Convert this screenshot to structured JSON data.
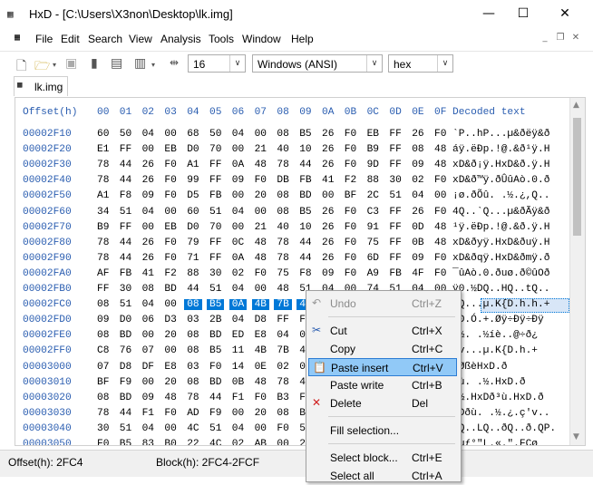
{
  "window": {
    "title": "HxD - [C:\\Users\\X3non\\Desktop\\lk.img]",
    "min_icon": "minimize-icon",
    "max_icon": "maximize-icon",
    "close_icon": "close-icon"
  },
  "menu": [
    "File",
    "Edit",
    "Search",
    "View",
    "Analysis",
    "Tools",
    "Window",
    "Help"
  ],
  "toolbar": {
    "bytes_per_row": "16",
    "charset": "Windows (ANSI)",
    "offset_base": "hex"
  },
  "tab": {
    "label": "lk.img"
  },
  "editor": {
    "offset_header": "Offset(h)",
    "columns": [
      "00",
      "01",
      "02",
      "03",
      "04",
      "05",
      "06",
      "07",
      "08",
      "09",
      "0A",
      "0B",
      "0C",
      "0D",
      "0E",
      "0F"
    ],
    "decoded_header": "Decoded text",
    "rows": [
      {
        "offset": "00002F10",
        "bytes": [
          "60",
          "50",
          "04",
          "00",
          "68",
          "50",
          "04",
          "00",
          "08",
          "B5",
          "26",
          "F0",
          "EB",
          "FF",
          "26",
          "F0"
        ],
        "decoded": "`P..hP...µ&ðëÿ&ð"
      },
      {
        "offset": "00002F20",
        "bytes": [
          "E1",
          "FF",
          "00",
          "EB",
          "D0",
          "70",
          "00",
          "21",
          "40",
          "10",
          "26",
          "F0",
          "B9",
          "FF",
          "08",
          "48"
        ],
        "decoded": "áÿ.ëÐp.!@.&ð¹ÿ.H"
      },
      {
        "offset": "00002F30",
        "bytes": [
          "78",
          "44",
          "26",
          "F0",
          "A1",
          "FF",
          "0A",
          "48",
          "78",
          "44",
          "26",
          "F0",
          "9D",
          "FF",
          "09",
          "48"
        ],
        "decoded": "xD&ð¡ÿ.HxD&ð.ÿ.H"
      },
      {
        "offset": "00002F40",
        "bytes": [
          "78",
          "44",
          "26",
          "F0",
          "99",
          "FF",
          "09",
          "F0",
          "DB",
          "FB",
          "41",
          "F2",
          "88",
          "30",
          "02",
          "F0"
        ],
        "decoded": "xD&ð™ÿ.ðÛûAò.0.ð"
      },
      {
        "offset": "00002F50",
        "bytes": [
          "A1",
          "F8",
          "09",
          "F0",
          "D5",
          "FB",
          "00",
          "20",
          "08",
          "BD",
          "00",
          "BF",
          "2C",
          "51",
          "04",
          "00"
        ],
        "decoded": "¡ø.ðÕû. .½.¿,Q.."
      },
      {
        "offset": "00002F60",
        "bytes": [
          "34",
          "51",
          "04",
          "00",
          "60",
          "51",
          "04",
          "00",
          "08",
          "B5",
          "26",
          "F0",
          "C3",
          "FF",
          "26",
          "F0"
        ],
        "decoded": "4Q..`Q...µ&ðÃÿ&ð"
      },
      {
        "offset": "00002F70",
        "bytes": [
          "B9",
          "FF",
          "00",
          "EB",
          "D0",
          "70",
          "00",
          "21",
          "40",
          "10",
          "26",
          "F0",
          "91",
          "FF",
          "0D",
          "48"
        ],
        "decoded": "¹ÿ.ëÐp.!@.&ð.ÿ.H"
      },
      {
        "offset": "00002F80",
        "bytes": [
          "78",
          "44",
          "26",
          "F0",
          "79",
          "FF",
          "0C",
          "48",
          "78",
          "44",
          "26",
          "F0",
          "75",
          "FF",
          "0B",
          "48"
        ],
        "decoded": "xD&ðyÿ.HxD&ðuÿ.H"
      },
      {
        "offset": "00002F90",
        "bytes": [
          "78",
          "44",
          "26",
          "F0",
          "71",
          "FF",
          "0A",
          "48",
          "78",
          "44",
          "26",
          "F0",
          "6D",
          "FF",
          "09",
          "F0"
        ],
        "decoded": "xD&ðqÿ.HxD&ðmÿ.ð"
      },
      {
        "offset": "00002FA0",
        "bytes": [
          "AF",
          "FB",
          "41",
          "F2",
          "88",
          "30",
          "02",
          "F0",
          "75",
          "F8",
          "09",
          "F0",
          "A9",
          "FB",
          "4F",
          "F0"
        ],
        "decoded": "¯ûAò.0.ðuø.ð©ûOð"
      },
      {
        "offset": "00002FB0",
        "bytes": [
          "FF",
          "30",
          "08",
          "BD",
          "44",
          "51",
          "04",
          "00",
          "48",
          "51",
          "04",
          "00",
          "74",
          "51",
          "04",
          "00"
        ],
        "decoded": "ÿ0.½DQ..HQ..tQ.."
      },
      {
        "offset": "00002FC0",
        "bytes": [
          "08",
          "51",
          "04",
          "00",
          "08",
          "B5",
          "0A",
          "4B",
          "7B",
          "44",
          "1B",
          "68",
          "1B",
          "68",
          "01",
          "2B"
        ],
        "decoded": ".Q...µ.K{D.h.h.+"
      },
      {
        "offset": "00002FD0",
        "bytes": [
          "09",
          "D0",
          "06",
          "D3",
          "03",
          "2B",
          "04",
          "D8",
          "FF",
          "F7",
          "",
          "",
          "",
          "",
          "",
          ""
        ],
        "decoded": ".Ð.Ó.+.Øÿ÷Ðÿ÷Ðÿ"
      },
      {
        "offset": "00002FE0",
        "bytes": [
          "08",
          "BD",
          "00",
          "20",
          "08",
          "BD",
          "ED",
          "E8",
          "04",
          "00",
          "",
          "",
          "",
          "",
          "",
          ""
        ],
        "decoded": ".½. .½íè..@÷ð¿"
      },
      {
        "offset": "00002FF0",
        "bytes": [
          "C8",
          "76",
          "07",
          "00",
          "08",
          "B5",
          "11",
          "4B",
          "7B",
          "44",
          "",
          "",
          "",
          "",
          "",
          ""
        ],
        "decoded": "Èv...µ.K{D.h.+"
      },
      {
        "offset": "00003000",
        "bytes": [
          "07",
          "D8",
          "DF",
          "E8",
          "03",
          "F0",
          "14",
          "0E",
          "02",
          "08",
          "",
          "",
          "",
          "",
          "",
          ""
        ],
        "decoded": ".ØßèHxD.ð"
      },
      {
        "offset": "00003010",
        "bytes": [
          "BF",
          "F9",
          "00",
          "20",
          "08",
          "BD",
          "0B",
          "48",
          "78",
          "44",
          "",
          "",
          "",
          "",
          "",
          ""
        ],
        "decoded": "¿ù. .½.HxD.ð"
      },
      {
        "offset": "00003020",
        "bytes": [
          "08",
          "BD",
          "09",
          "48",
          "78",
          "44",
          "F1",
          "F0",
          "B3",
          "F9",
          "",
          "",
          "",
          "",
          "",
          ""
        ],
        "decoded": ".½.HxDð³ù.HxD.ð"
      },
      {
        "offset": "00003030",
        "bytes": [
          "78",
          "44",
          "F1",
          "F0",
          "AD",
          "F9",
          "00",
          "20",
          "08",
          "BD",
          "",
          "",
          "",
          "",
          "",
          ""
        ],
        "decoded": "xDð­ù. .½.¿.ç'v.."
      },
      {
        "offset": "00003040",
        "bytes": [
          "30",
          "51",
          "04",
          "00",
          "4C",
          "51",
          "04",
          "00",
          "F0",
          "51",
          "",
          "",
          "",
          "",
          "",
          ""
        ],
        "decoded": "0Q..LQ..ðQ..ð.QP."
      },
      {
        "offset": "00003050",
        "bytes": [
          "F0",
          "B5",
          "83",
          "B0",
          "22",
          "4C",
          "02",
          "AB",
          "00",
          "22",
          "",
          "",
          "",
          "",
          "",
          ""
        ],
        "decoded": "ðµƒ°\"L.«.\".FCø"
      },
      {
        "offset": "00003060",
        "bytes": [
          "18",
          "46",
          "0E",
          "46",
          "7C",
          "44",
          "3D",
          "F0",
          "6F",
          "FD",
          "",
          "",
          "",
          "",
          "",
          ""
        ],
        "decoded": ".F.F|D=ðoý.F.°.."
      }
    ]
  },
  "status": {
    "offset": "Offset(h): 2FC4",
    "block": "Block(h): 2FC4-2FCF"
  },
  "context_menu": [
    {
      "label": "Undo",
      "shortcut": "Ctrl+Z",
      "icon": "undo-icon",
      "disabled": true
    },
    {
      "label": "Cut",
      "shortcut": "Ctrl+X",
      "icon": "scissors-icon"
    },
    {
      "label": "Copy",
      "shortcut": "Ctrl+C",
      "icon": ""
    },
    {
      "label": "Paste insert",
      "shortcut": "Ctrl+V",
      "icon": "paste-icon",
      "hover": true
    },
    {
      "label": "Paste write",
      "shortcut": "Ctrl+B",
      "icon": ""
    },
    {
      "label": "Delete",
      "shortcut": "Del",
      "icon": "delete-x-icon"
    },
    {
      "label": "Fill selection...",
      "shortcut": "",
      "icon": ""
    },
    {
      "label": "Select block...",
      "shortcut": "Ctrl+E",
      "icon": ""
    },
    {
      "label": "Select all",
      "shortcut": "Ctrl+A",
      "icon": ""
    }
  ],
  "colors": {
    "offset_blue": "#2a5db0",
    "selection": "#0078d7",
    "hover": "#91c9f7"
  }
}
